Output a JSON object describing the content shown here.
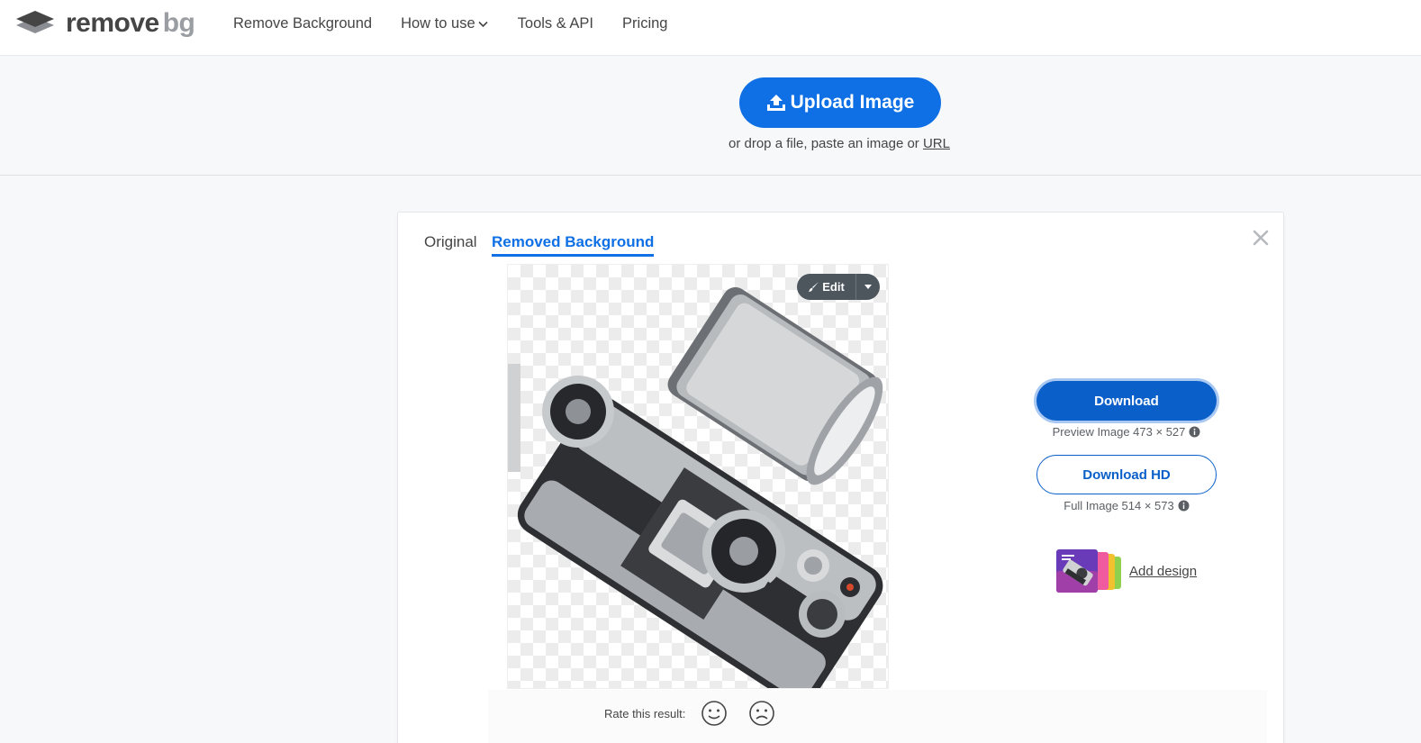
{
  "header": {
    "logo_remove": "remove",
    "logo_bg": "bg",
    "nav": [
      {
        "label": "Remove Background"
      },
      {
        "label": "How to use"
      },
      {
        "label": "Tools & API"
      },
      {
        "label": "Pricing"
      }
    ]
  },
  "upload": {
    "button_label": "Upload Image",
    "hint_prefix": "or drop a file, paste an image or",
    "hint_link": "URL"
  },
  "result": {
    "tabs": [
      {
        "label": "Original",
        "active": false
      },
      {
        "label": "Removed Background",
        "active": true
      }
    ],
    "edit_label": "Edit",
    "rate_label": "Rate this result:",
    "download": {
      "label": "Download",
      "sub": "Preview Image 473 × 527"
    },
    "download_hd": {
      "label": "Download HD",
      "sub": "Full Image 514 × 573"
    },
    "add_design_label": "Add design"
  },
  "colors": {
    "accent": "#0f70e6",
    "download_bg": "#0b5fc9",
    "text": "#454545",
    "page_bg": "#f7f8fa"
  },
  "icons": {
    "logo": "stacked-layers-logo-icon",
    "upload": "upload-arrow-icon",
    "close": "close-x-icon",
    "edit": "brush-icon",
    "info": "info-circle-icon",
    "rate_positive": "smiley-face-icon",
    "rate_negative": "frown-face-icon"
  }
}
